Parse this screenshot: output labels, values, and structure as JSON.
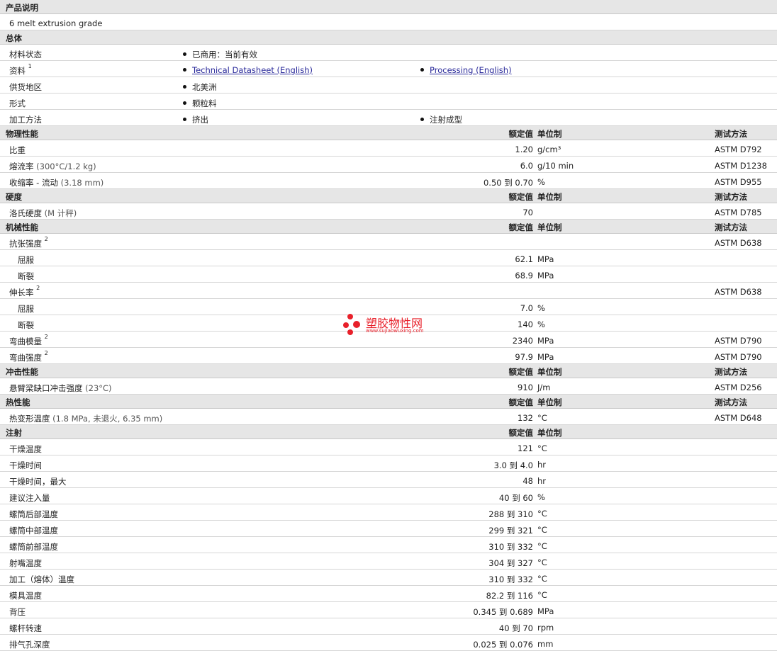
{
  "sections": {
    "desc": {
      "title": "产品说明",
      "text": "6 melt extrusion grade"
    },
    "general": {
      "title": "总体",
      "rows": [
        {
          "label": "材料状态",
          "b1": "已商用：当前有效",
          "b2": ""
        },
        {
          "label": "资料",
          "sup": "1",
          "b1": "Technical Datasheet (English)",
          "b2": "Processing (English)"
        },
        {
          "label": "供货地区",
          "b1": "北美洲",
          "b2": ""
        },
        {
          "label": "形式",
          "b1": "颗粒料",
          "b2": ""
        },
        {
          "label": "加工方法",
          "b1": "挤出",
          "b2": "注射成型"
        }
      ]
    },
    "physical": {
      "title": "物理性能",
      "h_val": "额定值",
      "h_unit": "单位制",
      "h_method": "测试方法",
      "rows": [
        {
          "label": "比重",
          "cond": "",
          "value": "1.20",
          "unit": "g/cm³",
          "method": "ASTM D792"
        },
        {
          "label": "熔流率",
          "cond": "(300°C/1.2 kg)",
          "value": "6.0",
          "unit": "g/10 min",
          "method": "ASTM D1238"
        },
        {
          "label": "收缩率 - 流动",
          "cond": "(3.18 mm)",
          "value": "0.50 到  0.70",
          "unit": "%",
          "method": "ASTM D955"
        }
      ]
    },
    "hardness": {
      "title": "硬度",
      "h_val": "额定值",
      "h_unit": "单位制",
      "h_method": "测试方法",
      "rows": [
        {
          "label": "洛氏硬度",
          "cond": "(M 计秤)",
          "value": "70",
          "unit": "",
          "method": "ASTM D785"
        }
      ]
    },
    "mechanical": {
      "title": "机械性能",
      "h_val": "额定值",
      "h_unit": "单位制",
      "h_method": "测试方法",
      "rows": [
        {
          "label": "抗张强度",
          "sup": "2",
          "value": "",
          "unit": "",
          "method": "ASTM D638",
          "sub": false
        },
        {
          "label": "屈服",
          "value": "62.1",
          "unit": "MPa",
          "method": "",
          "sub": true
        },
        {
          "label": "断裂",
          "value": "68.9",
          "unit": "MPa",
          "method": "",
          "sub": true
        },
        {
          "label": "伸长率",
          "sup": "2",
          "value": "",
          "unit": "",
          "method": "ASTM D638",
          "sub": false
        },
        {
          "label": "屈服",
          "value": "7.0",
          "unit": "%",
          "method": "",
          "sub": true
        },
        {
          "label": "断裂",
          "value": "140",
          "unit": "%",
          "method": "",
          "sub": true
        },
        {
          "label": "弯曲模量",
          "sup": "2",
          "value": "2340",
          "unit": "MPa",
          "method": "ASTM D790",
          "sub": false
        },
        {
          "label": "弯曲强度",
          "sup": "2",
          "value": "97.9",
          "unit": "MPa",
          "method": "ASTM D790",
          "sub": false
        }
      ]
    },
    "impact": {
      "title": "冲击性能",
      "h_val": "额定值",
      "h_unit": "单位制",
      "h_method": "测试方法",
      "rows": [
        {
          "label": "悬臂梁缺口冲击强度",
          "cond": "(23°C)",
          "value": "910",
          "unit": "J/m",
          "method": "ASTM D256"
        }
      ]
    },
    "thermal": {
      "title": "热性能",
      "h_val": "额定值",
      "h_unit": "单位制",
      "h_method": "测试方法",
      "rows": [
        {
          "label": "热变形温度",
          "cond": "(1.8 MPa, 未退火, 6.35 mm)",
          "value": "132",
          "unit": "°C",
          "method": "ASTM D648"
        }
      ]
    },
    "injection": {
      "title": "注射",
      "h_val": "额定值",
      "h_unit": "单位制",
      "rows": [
        {
          "label": "干燥温度",
          "value": "121",
          "unit": "°C"
        },
        {
          "label": "干燥时间",
          "value": "3.0 到  4.0",
          "unit": "hr"
        },
        {
          "label": "干燥时间，最大",
          "value": "48",
          "unit": "hr"
        },
        {
          "label": "建议注入量",
          "value": "40 到  60",
          "unit": "%"
        },
        {
          "label": "螺筒后部温度",
          "value": "288 到  310",
          "unit": "°C"
        },
        {
          "label": "螺筒中部温度",
          "value": "299 到  321",
          "unit": "°C"
        },
        {
          "label": "螺筒前部温度",
          "value": "310 到  332",
          "unit": "°C"
        },
        {
          "label": "射嘴温度",
          "value": "304 到  327",
          "unit": "°C"
        },
        {
          "label": "加工（熔体）温度",
          "value": "310 到  332",
          "unit": "°C"
        },
        {
          "label": "模具温度",
          "value": "82.2 到  116",
          "unit": "°C"
        },
        {
          "label": "背压",
          "value": "0.345 到  0.689",
          "unit": "MPa"
        },
        {
          "label": "螺杆转速",
          "value": "40 到  70",
          "unit": "rpm"
        },
        {
          "label": "排气孔深度",
          "value": "0.025 到  0.076",
          "unit": "mm"
        }
      ]
    }
  },
  "watermark": {
    "name": "塑胶物性网",
    "url": "www.sujiaowuxing.com",
    "color": "#e8202a"
  }
}
